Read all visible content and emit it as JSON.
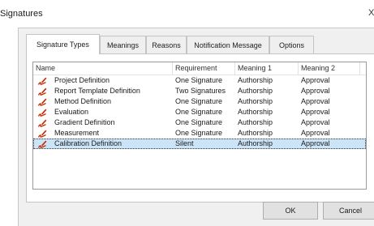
{
  "window": {
    "title": "Signatures",
    "close_glyph": "X"
  },
  "tabs": [
    {
      "label": "Signature Types",
      "active": true
    },
    {
      "label": "Meanings"
    },
    {
      "label": "Reasons"
    },
    {
      "label": "Notification Message"
    },
    {
      "label": "Options"
    }
  ],
  "table": {
    "columns": [
      "Name",
      "Requirement",
      "Meaning 1",
      "Meaning 2"
    ],
    "rows": [
      {
        "name": "Project Definition",
        "requirement": "One Signature",
        "meaning1": "Authorship",
        "meaning2": "Approval"
      },
      {
        "name": "Report Template Definition",
        "requirement": "Two Signatures",
        "meaning1": "Authorship",
        "meaning2": "Approval"
      },
      {
        "name": "Method Definition",
        "requirement": "One Signature",
        "meaning1": "Authorship",
        "meaning2": "Approval"
      },
      {
        "name": "Evaluation",
        "requirement": "One Signature",
        "meaning1": "Authorship",
        "meaning2": "Approval"
      },
      {
        "name": "Gradient Definition",
        "requirement": "One Signature",
        "meaning1": "Authorship",
        "meaning2": "Approval"
      },
      {
        "name": "Measurement",
        "requirement": "One Signature",
        "meaning1": "Authorship",
        "meaning2": "Approval"
      },
      {
        "name": "Calibration Definition",
        "requirement": "Silent",
        "meaning1": "Authorship",
        "meaning2": "Approval",
        "selected": true
      }
    ],
    "row_icon": "pen-signature-icon"
  },
  "buttons": {
    "ok": "OK",
    "cancel": "Cancel"
  }
}
